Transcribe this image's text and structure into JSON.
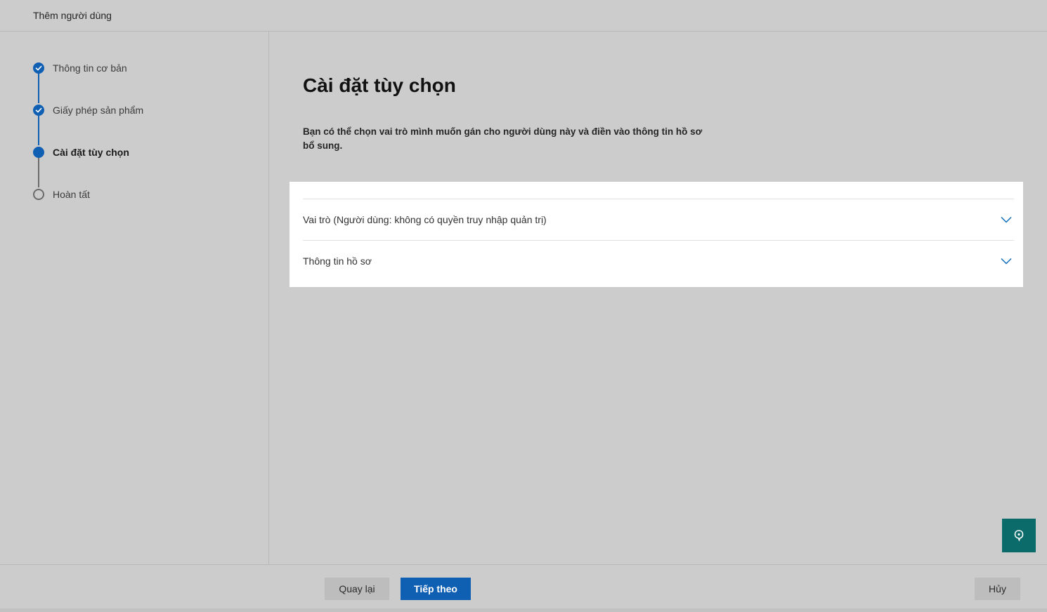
{
  "header": {
    "title": "Thêm người dùng"
  },
  "steps": [
    {
      "label": "Thông tin cơ bản",
      "state": "done"
    },
    {
      "label": "Giấy phép sản phẩm",
      "state": "done"
    },
    {
      "label": "Cài đặt tùy chọn",
      "state": "current"
    },
    {
      "label": "Hoàn tất",
      "state": "todo"
    }
  ],
  "main": {
    "title": "Cài đặt tùy chọn",
    "description": "Bạn có thể chọn vai trò mình muốn gán cho người dùng này và điền vào thông tin hồ sơ bổ sung.",
    "sections": [
      {
        "label": "Vai trò (Người dùng: không có quyền truy nhập quản trị)",
        "icon": "chevron-down-icon"
      },
      {
        "label": "Thông tin hồ sơ",
        "icon": "chevron-down-icon"
      }
    ]
  },
  "help": {
    "icon": "help-chat-icon"
  },
  "footer": {
    "back_label": "Quay lại",
    "next_label": "Tiếp theo",
    "cancel_label": "Hủy"
  },
  "colors": {
    "accent": "#0f5fb3",
    "help": "#0b6a6a",
    "background": "#cccccc"
  }
}
